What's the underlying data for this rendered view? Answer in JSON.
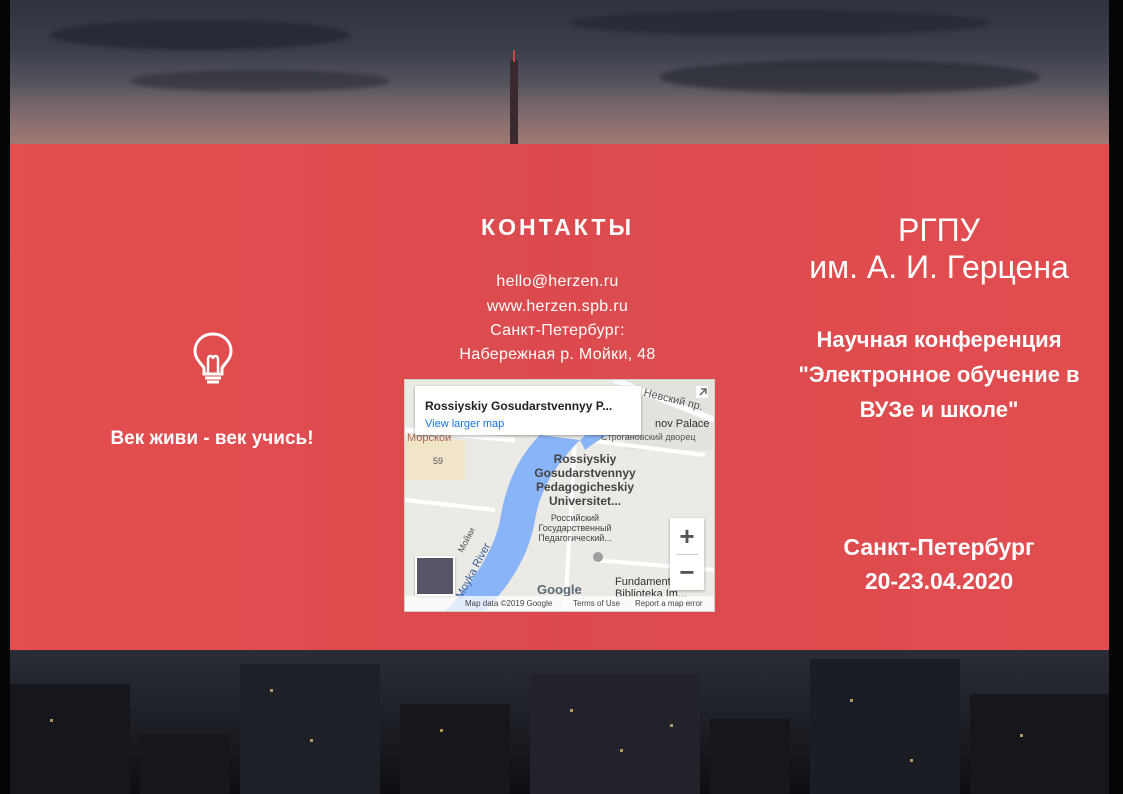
{
  "left": {
    "icon": "lightbulb-icon",
    "motto": "Век живи - век учись!"
  },
  "contacts": {
    "title": "КОНТАКТЫ",
    "email": "hello@herzen.ru",
    "website": "www.herzen.spb.ru",
    "city": "Санкт-Петербург:",
    "address": "Набережная р. Мойки, 48"
  },
  "map": {
    "card_title": "Rossiyskiy Gosudarstvennyy P...",
    "card_link": "View larger map",
    "poi_lines": [
      "Rossiyskiy",
      "Gosudarstvennyy",
      "Pedagogicheskiy",
      "Universitet..."
    ],
    "poi_ru_lines": [
      "Российский",
      "Государственный",
      "Педагогический..."
    ],
    "labels": {
      "nevsky": "Невский пр.",
      "palace_en": "nov Palace",
      "palace_ru": "Строгановский дворец",
      "morskaya": "Морской",
      "num59": "59",
      "river": "Moyka River",
      "library": "Fundamental'n",
      "library2": "Biblioteka Im...",
      "moika": "Мойки"
    },
    "zoom_in": "+",
    "zoom_out": "−",
    "google": "Google",
    "footer_data": "Map data ©2019 Google",
    "footer_terms": "Terms of Use",
    "footer_report": "Report a map error"
  },
  "right": {
    "university_line1": "РГПУ",
    "university_line2": "им. А. И. Герцена",
    "conference": "Научная конференция \"Электронное обучение в ВУЗе и школе\"",
    "city": "Санкт-Петербург",
    "dates": "20-23.04.2020"
  },
  "colors": {
    "band": "#e94f52",
    "text": "#ffffff"
  }
}
